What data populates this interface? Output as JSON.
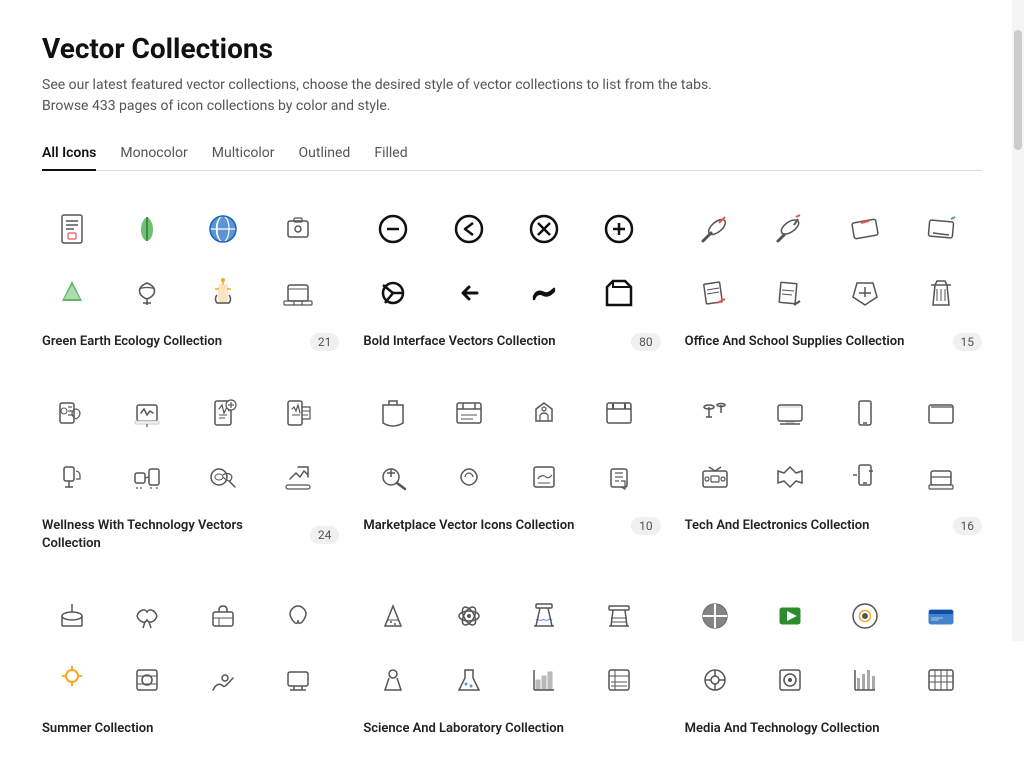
{
  "page": {
    "title": "Vector Collections",
    "subtitle_line1": "See our latest featured vector collections, choose the desired style of vector collections to list from the tabs.",
    "subtitle_line2": "Browse 433 pages of icon collections by color and style."
  },
  "tabs": [
    {
      "id": "all",
      "label": "All Icons",
      "active": true
    },
    {
      "id": "monocolor",
      "label": "Monocolor",
      "active": false
    },
    {
      "id": "multicolor",
      "label": "Multicolor",
      "active": false
    },
    {
      "id": "outlined",
      "label": "Outlined",
      "active": false
    },
    {
      "id": "filled",
      "label": "Filled",
      "active": false
    }
  ],
  "collections": [
    {
      "id": "green-earth",
      "name": "Green Earth Ecology Collection",
      "count": "21",
      "row": 1
    },
    {
      "id": "bold-interface",
      "name": "Bold Interface Vectors Collection",
      "count": "80",
      "row": 1
    },
    {
      "id": "office-school",
      "name": "Office And School Supplies Collection",
      "count": "15",
      "row": 1
    },
    {
      "id": "wellness-tech",
      "name": "Wellness With Technology Vectors Collection",
      "count": "24",
      "row": 2
    },
    {
      "id": "marketplace",
      "name": "Marketplace Vector Icons Collection",
      "count": "10",
      "row": 2
    },
    {
      "id": "tech-electronics",
      "name": "Tech And Electronics Collection",
      "count": "16",
      "row": 2
    },
    {
      "id": "summer",
      "name": "Summer Collection",
      "count": "",
      "row": 3
    },
    {
      "id": "science",
      "name": "Science And Laboratory Collection",
      "count": "",
      "row": 3
    },
    {
      "id": "media",
      "name": "Media And Technology Collection",
      "count": "",
      "row": 3
    }
  ]
}
